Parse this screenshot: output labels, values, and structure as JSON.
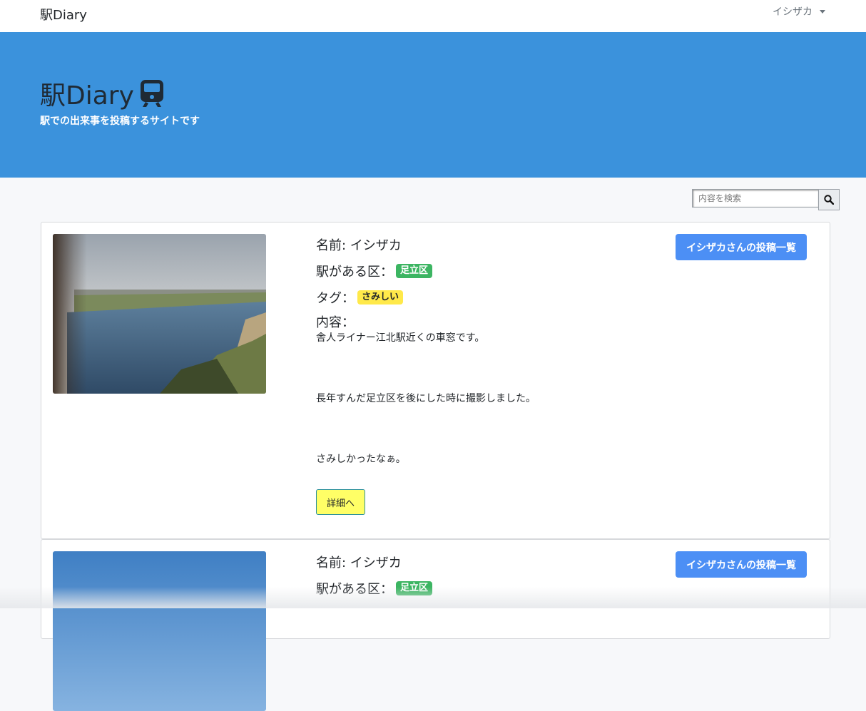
{
  "navbar": {
    "brand": "駅Diary",
    "user": "イシザカ"
  },
  "hero": {
    "title": "駅Diary",
    "subtitle": "駅での出来事を投稿するサイトです"
  },
  "search": {
    "placeholder": "内容を検索"
  },
  "posts": [
    {
      "name_label": "名前: イシザカ",
      "ward_label": "駅がある区：",
      "ward": "足立区",
      "tag_label": "タグ：",
      "tag": "さみしい",
      "content_label": "内容：",
      "content_lines": [
        "舎人ライナー江北駅近くの車窓です。",
        "長年すんだ足立区を後にした時に撮影しました。",
        "さみしかったなぁ。"
      ],
      "detail_button": "詳細へ",
      "posts_button": "イシザカさんの投稿一覧"
    },
    {
      "name_label": "名前: イシザカ",
      "ward_label": "駅がある区：",
      "ward": "足立区",
      "posts_button": "イシザカさんの投稿一覧"
    }
  ],
  "colors": {
    "hero_bg": "#3b92dc",
    "primary_button": "#4c8ff5",
    "ward_badge": "#3cb562",
    "tag_badge": "#ffe94a",
    "detail_button": "#ffff66"
  }
}
